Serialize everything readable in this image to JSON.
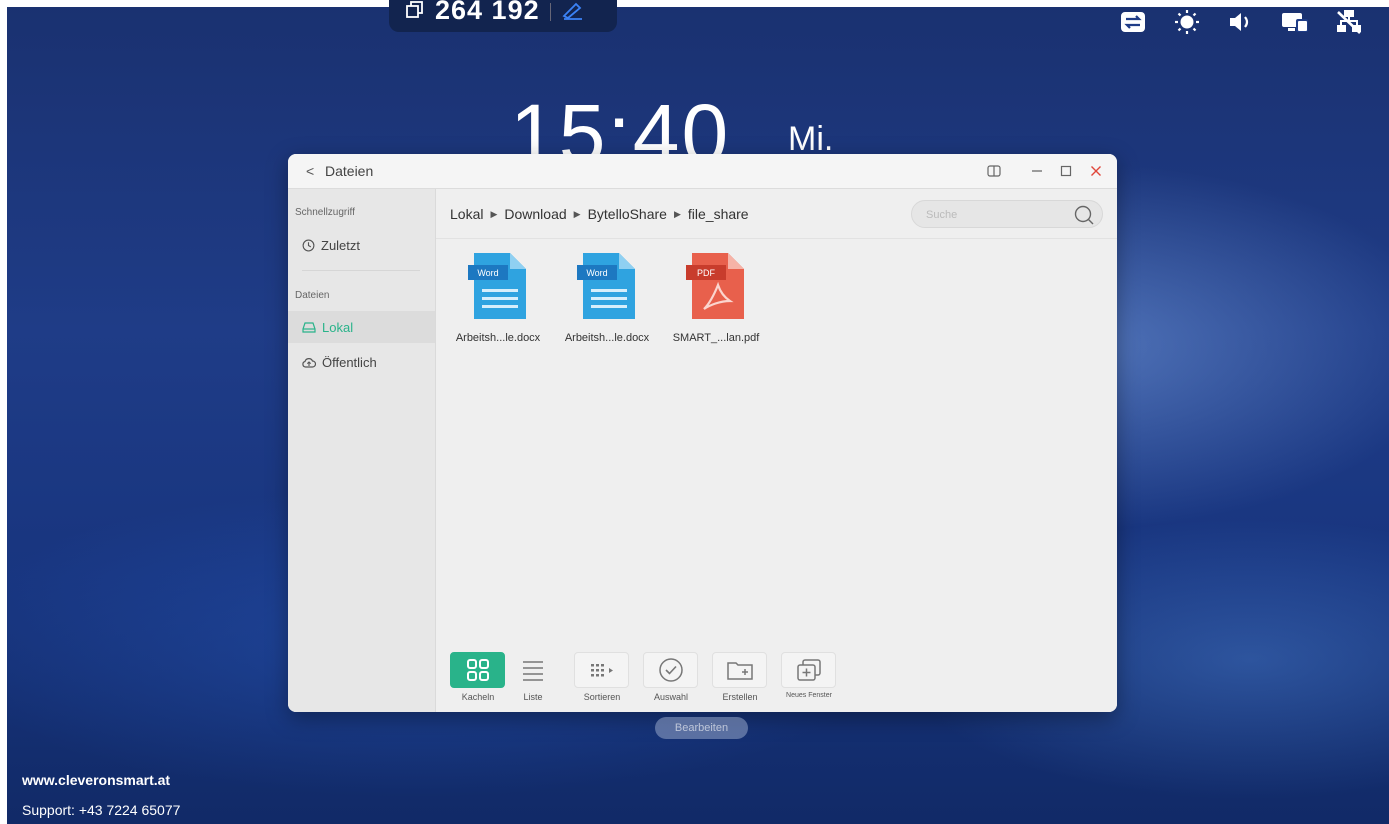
{
  "topbar": {
    "meeting_id": "264 192"
  },
  "clock": {
    "time": "15:40",
    "day": "Mi."
  },
  "status_icons": [
    "switch-icon",
    "brightness-icon",
    "volume-icon",
    "screen-share-icon",
    "network-disconnected-icon"
  ],
  "window": {
    "back_label": "<",
    "title": "Dateien",
    "sidebar": {
      "quick_access_header": "Schnellzugriff",
      "recent_label": "Zuletzt",
      "files_header": "Dateien",
      "local_label": "Lokal",
      "public_label": "Öffentlich"
    },
    "breadcrumb": [
      "Lokal",
      "Download",
      "BytelloShare",
      "file_share"
    ],
    "search": {
      "placeholder": "Suche"
    },
    "files": [
      {
        "name": "Arbeitsh...le.docx",
        "type": "Word"
      },
      {
        "name": "Arbeitsh...le.docx",
        "type": "Word"
      },
      {
        "name": "SMART_...lan.pdf",
        "type": "PDF"
      }
    ],
    "toolbar": {
      "tiles": "Kacheln",
      "list": "Liste",
      "sort": "Sortieren",
      "select": "Auswahl",
      "create": "Erstellen",
      "new_window": "Neues Fenster"
    }
  },
  "edit_button": "Bearbeiten",
  "footer": {
    "url": "www.cleveronsmart.at",
    "support": "Support: +43 7224 65077"
  },
  "colors": {
    "accent": "#29b38a",
    "word": "#2fa3e0",
    "pdf": "#e8604c",
    "close": "#e0463a"
  }
}
